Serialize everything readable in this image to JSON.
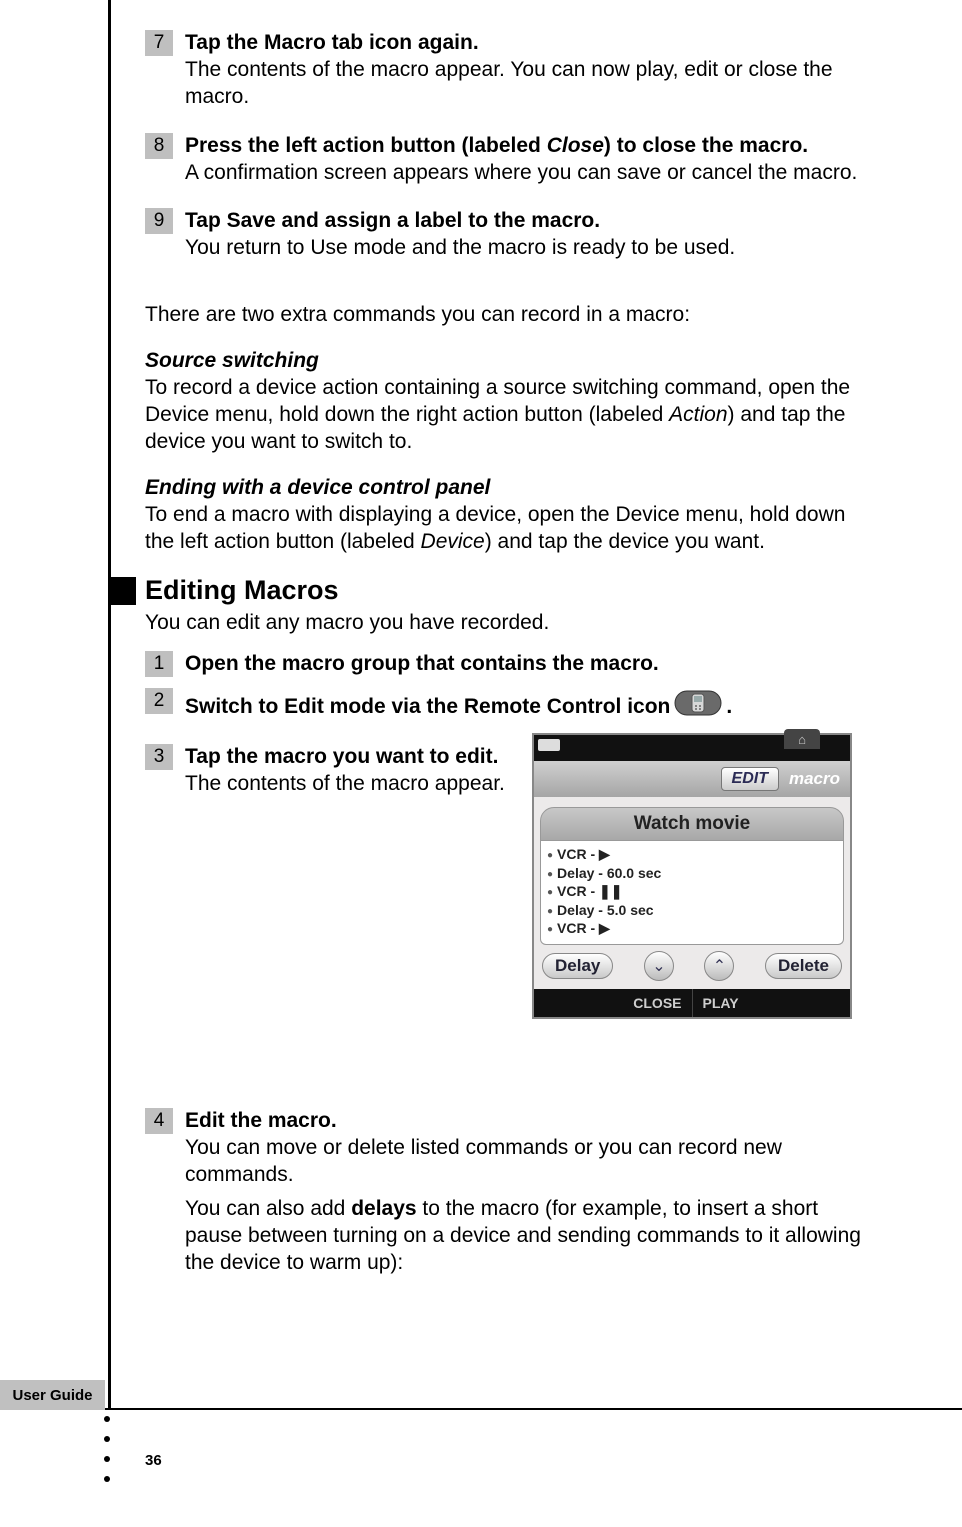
{
  "footer": {
    "label": "User Guide",
    "page_number": "36"
  },
  "steps_a": [
    {
      "n": "7",
      "title": "Tap the Macro tab icon again.",
      "body": "The contents of the macro appear. You can now play, edit or close the macro."
    },
    {
      "n": "8",
      "title_pre": "Press the left action button (labeled ",
      "title_em": "Close",
      "title_post": ") to close the macro.",
      "body": "A confirmation screen appears where you can save or cancel the macro."
    },
    {
      "n": "9",
      "title": "Tap Save and assign a label to the macro.",
      "body": "You return to Use mode and the macro is ready to be used."
    }
  ],
  "intro_after": "There are two extra commands you can record in a macro:",
  "sub1": {
    "head": "Source switching",
    "body_pre": "To record a device action containing a source switching command, open the Device menu, hold down the right action button (labeled ",
    "body_em": "Action",
    "body_post": ") and tap the device you want to switch to."
  },
  "sub2": {
    "head": "Ending with a device control panel",
    "body_pre": "To end a macro with displaying a device, open the Device menu, hold down the left action button (labeled ",
    "body_em": "Device",
    "body_post": ") and tap the device you want."
  },
  "section": {
    "title": "Editing Macros",
    "intro": "You can edit any macro you have recorded."
  },
  "steps_b": {
    "s1": {
      "n": "1",
      "title": "Open the macro group that contains the macro."
    },
    "s2": {
      "n": "2",
      "title_pre": "Switch to Edit mode via the Remote Control icon ",
      "title_post": "."
    },
    "s3": {
      "n": "3",
      "title": "Tap the macro you want to edit.",
      "body": "The contents of the macro appear."
    },
    "s4": {
      "n": "4",
      "title": "Edit the macro.",
      "body1": "You can move or delete listed commands or you can record new commands.",
      "body2_pre": "You can also add ",
      "body2_b": "delays",
      "body2_post": " to the macro (for example, to insert a short pause between turning on a device and sending commands to it allowing the device to warm up):"
    }
  },
  "device": {
    "edit_btn": "EDIT",
    "macro_label": "macro",
    "title": "Watch movie",
    "list": [
      "VCR - ▶",
      "Delay - 60.0 sec",
      "VCR - ❚❚",
      "Delay - 5.0 sec",
      "VCR - ▶"
    ],
    "delay_btn": "Delay",
    "delete_btn": "Delete",
    "close_btn": "CLOSE",
    "play_btn": "PLAY"
  }
}
